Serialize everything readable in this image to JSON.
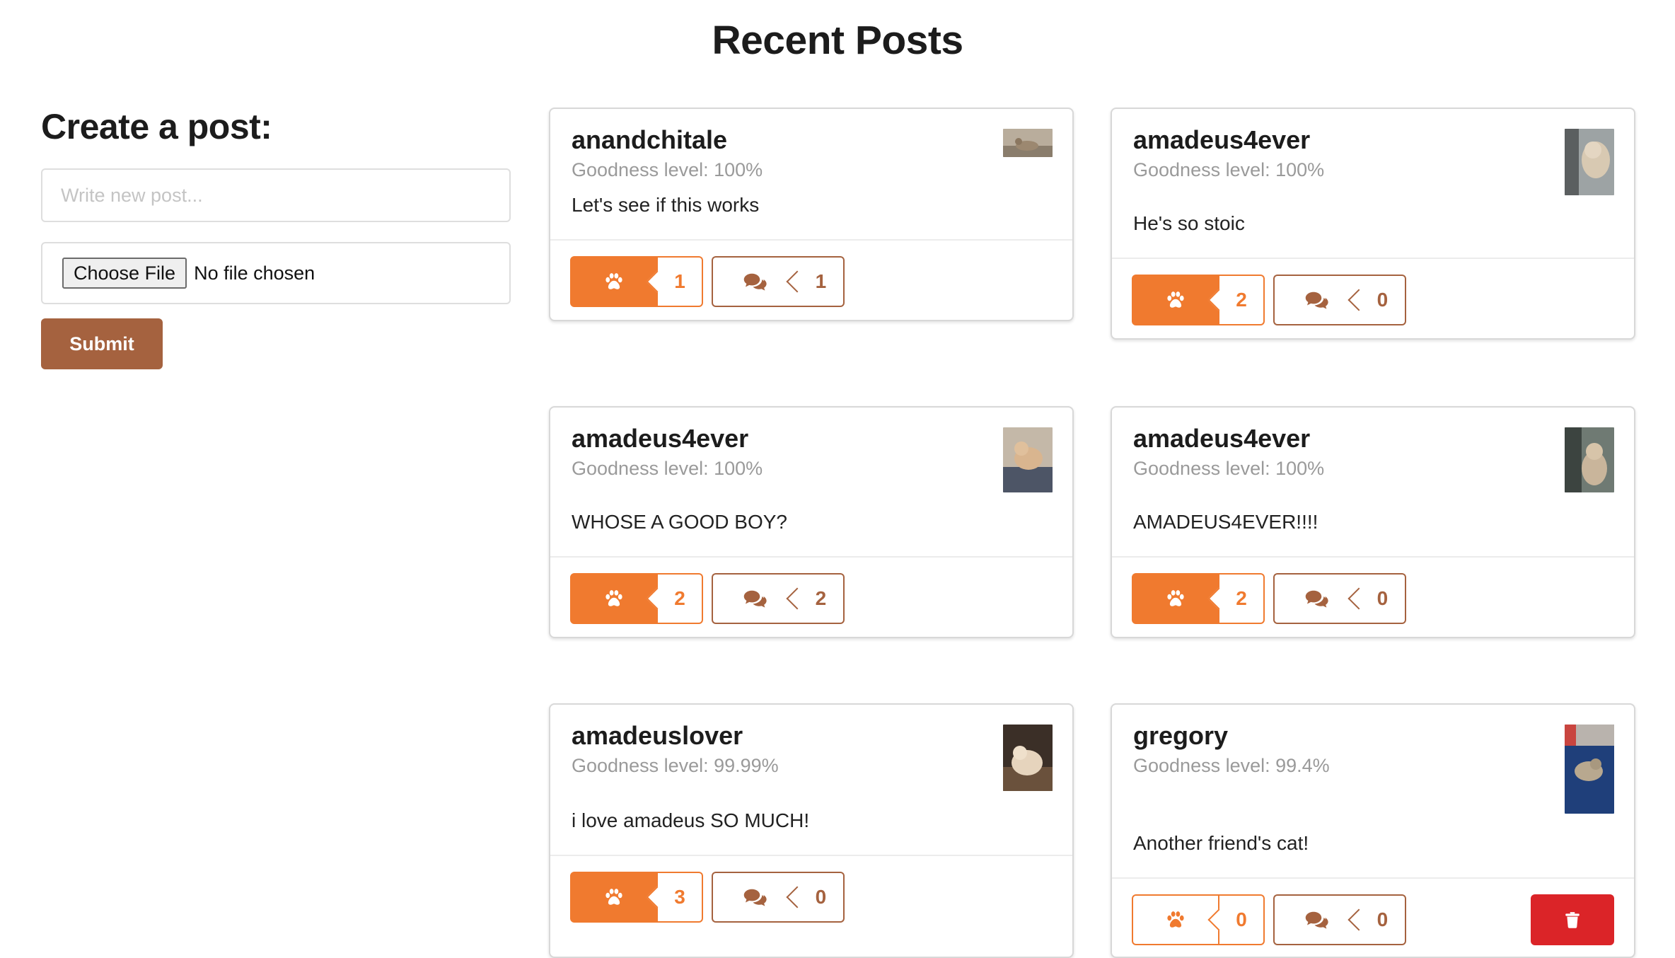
{
  "page": {
    "title": "Recent Posts"
  },
  "create_post": {
    "heading": "Create a post:",
    "placeholder": "Write new post...",
    "file_button": "Choose File",
    "file_status": "No file chosen",
    "submit_label": "Submit"
  },
  "posts": [
    {
      "author": "anandchitale",
      "goodness": "Goodness level: 100%",
      "text": "Let's see if this works",
      "likes": "1",
      "comments": "1"
    },
    {
      "author": "amadeus4ever",
      "goodness": "Goodness level: 100%",
      "text": "He's so stoic",
      "likes": "2",
      "comments": "0"
    },
    {
      "author": "amadeus4ever",
      "goodness": "Goodness level: 100%",
      "text": "WHOSE A GOOD BOY?",
      "likes": "2",
      "comments": "2"
    },
    {
      "author": "amadeus4ever",
      "goodness": "Goodness level: 100%",
      "text": "AMADEUS4EVER!!!!",
      "likes": "2",
      "comments": "0"
    },
    {
      "author": "amadeuslover",
      "goodness": "Goodness level: 99.99%",
      "text": "i love amadeus SO MUCH!",
      "likes": "3",
      "comments": "0"
    },
    {
      "author": "gregory",
      "goodness": "Goodness level: 99.4%",
      "text": "Another friend's cat!",
      "likes": "0",
      "comments": "0"
    }
  ],
  "colors": {
    "accent": "#f07a2f",
    "brown": "#a5623f",
    "danger": "#db2428"
  },
  "icons": {
    "like": "paw-icon",
    "comment": "comments-icon",
    "delete": "trash-icon"
  }
}
